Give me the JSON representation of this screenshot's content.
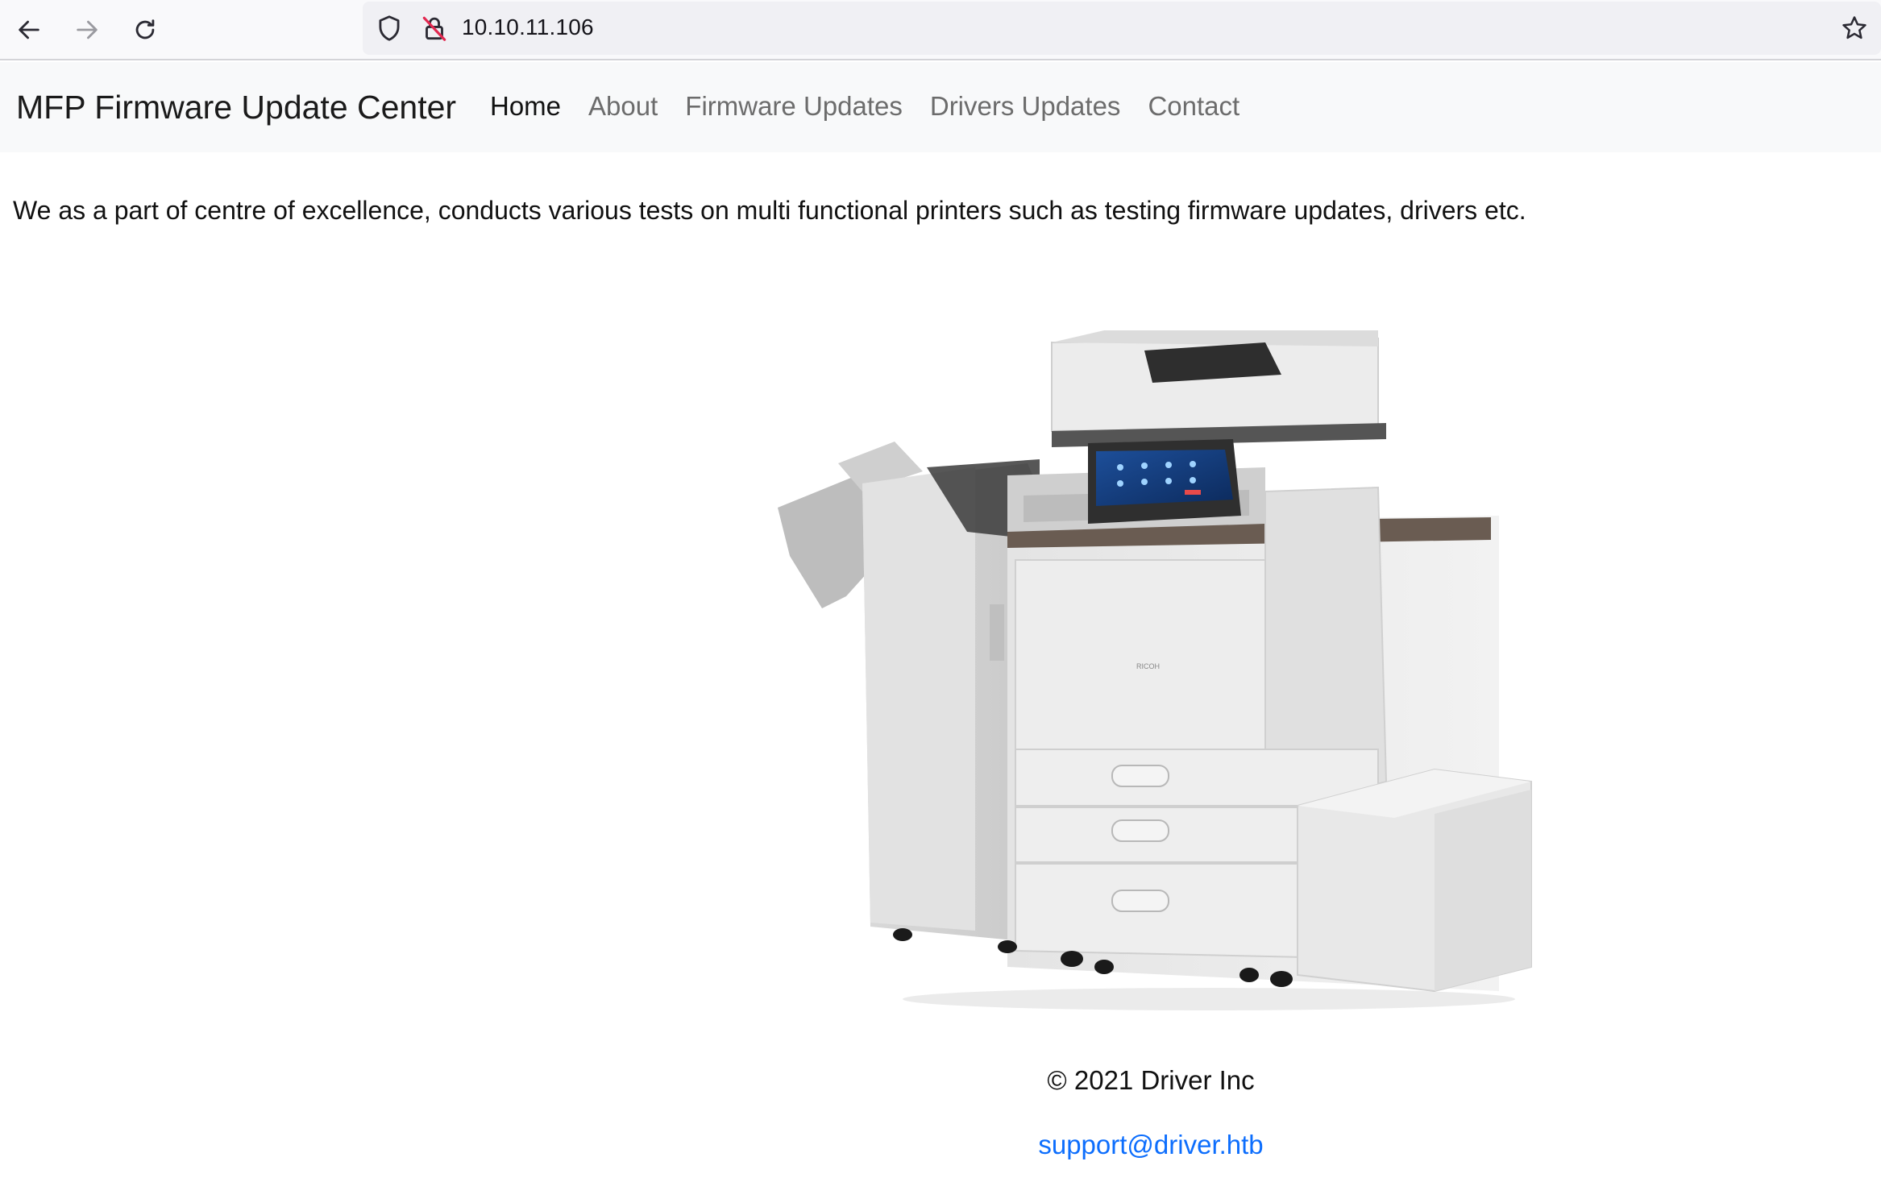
{
  "browser": {
    "url": "10.10.11.106",
    "icons": {
      "back": "arrow-left-icon",
      "forward": "arrow-right-icon",
      "reload": "reload-icon",
      "tracking": "shield-icon",
      "insecure": "insecure-lock-icon",
      "bookmark": "star-icon"
    }
  },
  "navbar": {
    "brand": "MFP Firmware Update Center",
    "links": [
      {
        "label": "Home",
        "active": true
      },
      {
        "label": "About",
        "active": false
      },
      {
        "label": "Firmware Updates",
        "active": false
      },
      {
        "label": "Drivers Updates",
        "active": false
      },
      {
        "label": "Contact",
        "active": false
      }
    ]
  },
  "main": {
    "intro": "We as a part of centre of excellence, conducts various tests on multi functional printers such as testing firmware updates, drivers etc.",
    "image_subject": "multifunction printer"
  },
  "footer": {
    "copyright": "© 2021 Driver Inc",
    "email": "support@driver.htb"
  },
  "colors": {
    "navbar_bg": "#f8f9fa",
    "link_active": "#111111",
    "link_muted": "#6c6c6c",
    "email_link": "#0d6efd"
  }
}
